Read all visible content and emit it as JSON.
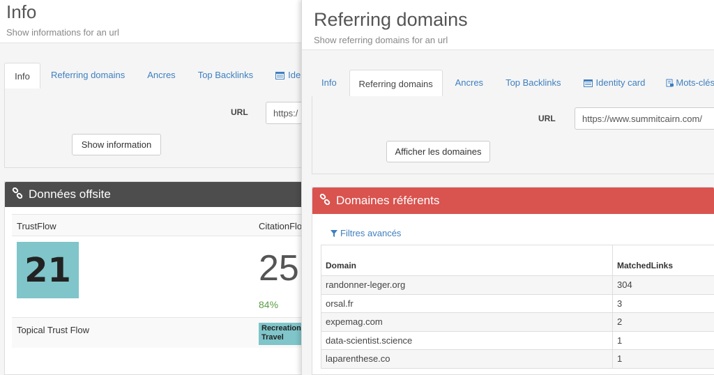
{
  "left": {
    "title": "Info",
    "subtitle": "Show informations for an url",
    "tabs": [
      {
        "label": "Info",
        "active": true
      },
      {
        "label": "Referring domains",
        "active": false
      },
      {
        "label": "Ancres",
        "active": false
      },
      {
        "label": "Top Backlinks",
        "active": false
      },
      {
        "label": "Iden",
        "active": false,
        "icon": "id-card-icon"
      }
    ],
    "url_label": "URL",
    "url_value": "https:/",
    "button": "Show information",
    "card_title": "Données offsite",
    "trust_flow_label": "TrustFlow",
    "citation_flow_label": "CitationFlow",
    "trust_flow_value": "21",
    "citation_flow_value": "25",
    "citation_flow_pct": "84%",
    "topical_label": "Topical Trust Flow",
    "topic_badge": "Recreation/\nTravel",
    "colors": {
      "card_head": "#4d4d4d",
      "score_bg": "#7fc5c9"
    }
  },
  "right": {
    "title": "Referring domains",
    "subtitle": "Show referring domains for an url",
    "tabs": [
      {
        "label": "Info",
        "active": false
      },
      {
        "label": "Referring domains",
        "active": true
      },
      {
        "label": "Ancres",
        "active": false
      },
      {
        "label": "Top Backlinks",
        "active": false
      },
      {
        "label": "Identity card",
        "active": false,
        "icon": "id-card-icon"
      },
      {
        "label": "Mots-clés",
        "active": false,
        "icon": "keywords-icon"
      }
    ],
    "url_label": "URL",
    "url_value": "https://www.summitcairn.com/",
    "button": "Afficher les domaines",
    "card_title": "Domaines référents",
    "filter_label": "Filtres avancés",
    "table": {
      "headers": [
        "Domain",
        "MatchedLinks"
      ],
      "rows": [
        [
          "randonner-leger.org",
          "304"
        ],
        [
          "orsal.fr",
          "3"
        ],
        [
          "expemag.com",
          "2"
        ],
        [
          "data-scientist.science",
          "1"
        ],
        [
          "laparenthese.co",
          "1"
        ]
      ]
    },
    "colors": {
      "card_head": "#d9534f",
      "link": "#3e7fbf"
    }
  }
}
